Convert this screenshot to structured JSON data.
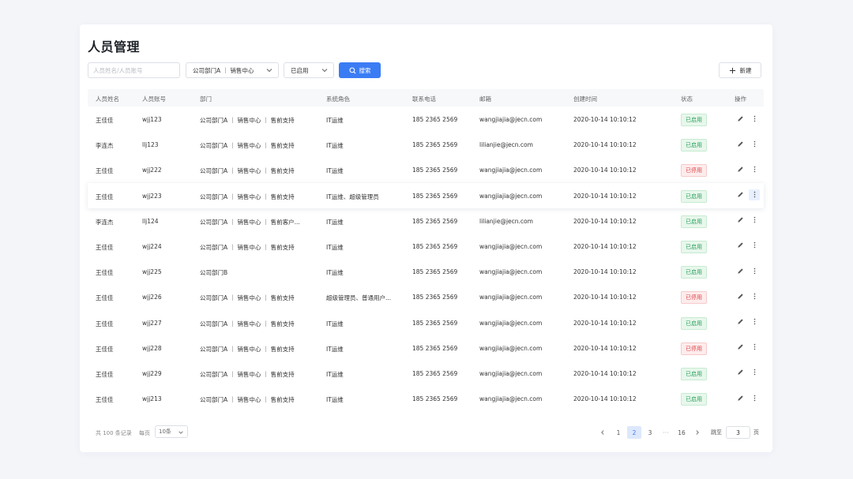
{
  "page": {
    "title": "人员管理"
  },
  "toolbar": {
    "search_placeholder": "人员姓名/人员账号",
    "dept_value": "公司部门A ｜ 销售中心",
    "status_value": "已启用",
    "search_label": "搜索",
    "new_label": "新建",
    "icons": {
      "search": "search-icon",
      "dropdown": "chevron-down-icon",
      "add": "plus-icon"
    }
  },
  "accent_color": "#3b7cf4",
  "table": {
    "headers": [
      "人员姓名",
      "人员账号",
      "部门",
      "系统角色",
      "联系电话",
      "邮箱",
      "创建时间",
      "状态",
      "操作"
    ],
    "rows": [
      {
        "name": "王佳佳",
        "account": "wjj123",
        "dept": "公司部门A ｜ 销售中心 ｜ 售前支持",
        "role": "IT运维",
        "phone": "185 2365 2569",
        "email": "wangjiajia@jecn.com",
        "created": "2020-10-14  10:10:12",
        "status": "已启用",
        "status_kind": "on"
      },
      {
        "name": "李连杰",
        "account": "llj123",
        "dept": "公司部门A ｜ 销售中心 ｜ 售前支持",
        "role": "IT运维",
        "phone": "185 2365 2569",
        "email": "lilianjie@jecn.com",
        "created": "2020-10-14  10:10:12",
        "status": "已启用",
        "status_kind": "on"
      },
      {
        "name": "王佳佳",
        "account": "wjj222",
        "dept": "公司部门A ｜ 销售中心 ｜ 售前支持",
        "role": "IT运维",
        "phone": "185 2365 2569",
        "email": "wangjiajia@jecn.com",
        "created": "2020-10-14  10:10:12",
        "status": "已停用",
        "status_kind": "off"
      },
      {
        "name": "王佳佳",
        "account": "wjj223",
        "dept": "公司部门A ｜ 销售中心 ｜ 售前支持",
        "role": "IT运维、超级管理员",
        "phone": "185 2365 2569",
        "email": "wangjiajia@jecn.com",
        "created": "2020-10-14  10:10:12",
        "status": "已启用",
        "status_kind": "on",
        "hovered": true
      },
      {
        "name": "李连杰",
        "account": "llj124",
        "dept": "公司部门A ｜ 销售中心 ｜ 售前客户...",
        "role": "IT运维",
        "phone": "185 2365 2569",
        "email": "lilianjie@jecn.com",
        "created": "2020-10-14  10:10:12",
        "status": "已启用",
        "status_kind": "on"
      },
      {
        "name": "王佳佳",
        "account": "wjj224",
        "dept": "公司部门A ｜ 销售中心 ｜ 售前支持",
        "role": "IT运维",
        "phone": "185 2365 2569",
        "email": "wangjiajia@jecn.com",
        "created": "2020-10-14  10:10:12",
        "status": "已启用",
        "status_kind": "on"
      },
      {
        "name": "王佳佳",
        "account": "wjj225",
        "dept": "公司部门B",
        "role": "IT运维",
        "phone": "185 2365 2569",
        "email": "wangjiajia@jecn.com",
        "created": "2020-10-14  10:10:12",
        "status": "已启用",
        "status_kind": "on"
      },
      {
        "name": "王佳佳",
        "account": "wjj226",
        "dept": "公司部门A ｜ 销售中心 ｜ 售前支持",
        "role": "超级管理员、普通用户...",
        "phone": "185 2365 2569",
        "email": "wangjiajia@jecn.com",
        "created": "2020-10-14  10:10:12",
        "status": "已停用",
        "status_kind": "off"
      },
      {
        "name": "王佳佳",
        "account": "wjj227",
        "dept": "公司部门A ｜ 销售中心 ｜ 售前支持",
        "role": "IT运维",
        "phone": "185 2365 2569",
        "email": "wangjiajia@jecn.com",
        "created": "2020-10-14  10:10:12",
        "status": "已启用",
        "status_kind": "on"
      },
      {
        "name": "王佳佳",
        "account": "wjj228",
        "dept": "公司部门A ｜ 销售中心 ｜ 售前支持",
        "role": "IT运维",
        "phone": "185 2365 2569",
        "email": "wangjiajia@jecn.com",
        "created": "2020-10-14  10:10:12",
        "status": "已停用",
        "status_kind": "off"
      },
      {
        "name": "王佳佳",
        "account": "wjj229",
        "dept": "公司部门A ｜ 销售中心 ｜ 售前支持",
        "role": "IT运维",
        "phone": "185 2365 2569",
        "email": "wangjiajia@jecn.com",
        "created": "2020-10-14  10:10:12",
        "status": "已启用",
        "status_kind": "on"
      },
      {
        "name": "王佳佳",
        "account": "wjj213",
        "dept": "公司部门A ｜ 销售中心 ｜ 售前支持",
        "role": "IT运维",
        "phone": "185 2365 2569",
        "email": "wangjiajia@jecn.com",
        "created": "2020-10-14  10:10:12",
        "status": "已启用",
        "status_kind": "on"
      }
    ]
  },
  "status_colors": {
    "on": "#27a15a",
    "off": "#e0454a"
  },
  "footer": {
    "total_label": "共 100 条记录",
    "per_page_label": "每页",
    "per_page_value": "10条",
    "pages": [
      "1",
      "2",
      "3",
      "···",
      "16"
    ],
    "current_page": "2",
    "goto_label": "跳至",
    "goto_value": "3",
    "goto_suffix": "页"
  }
}
